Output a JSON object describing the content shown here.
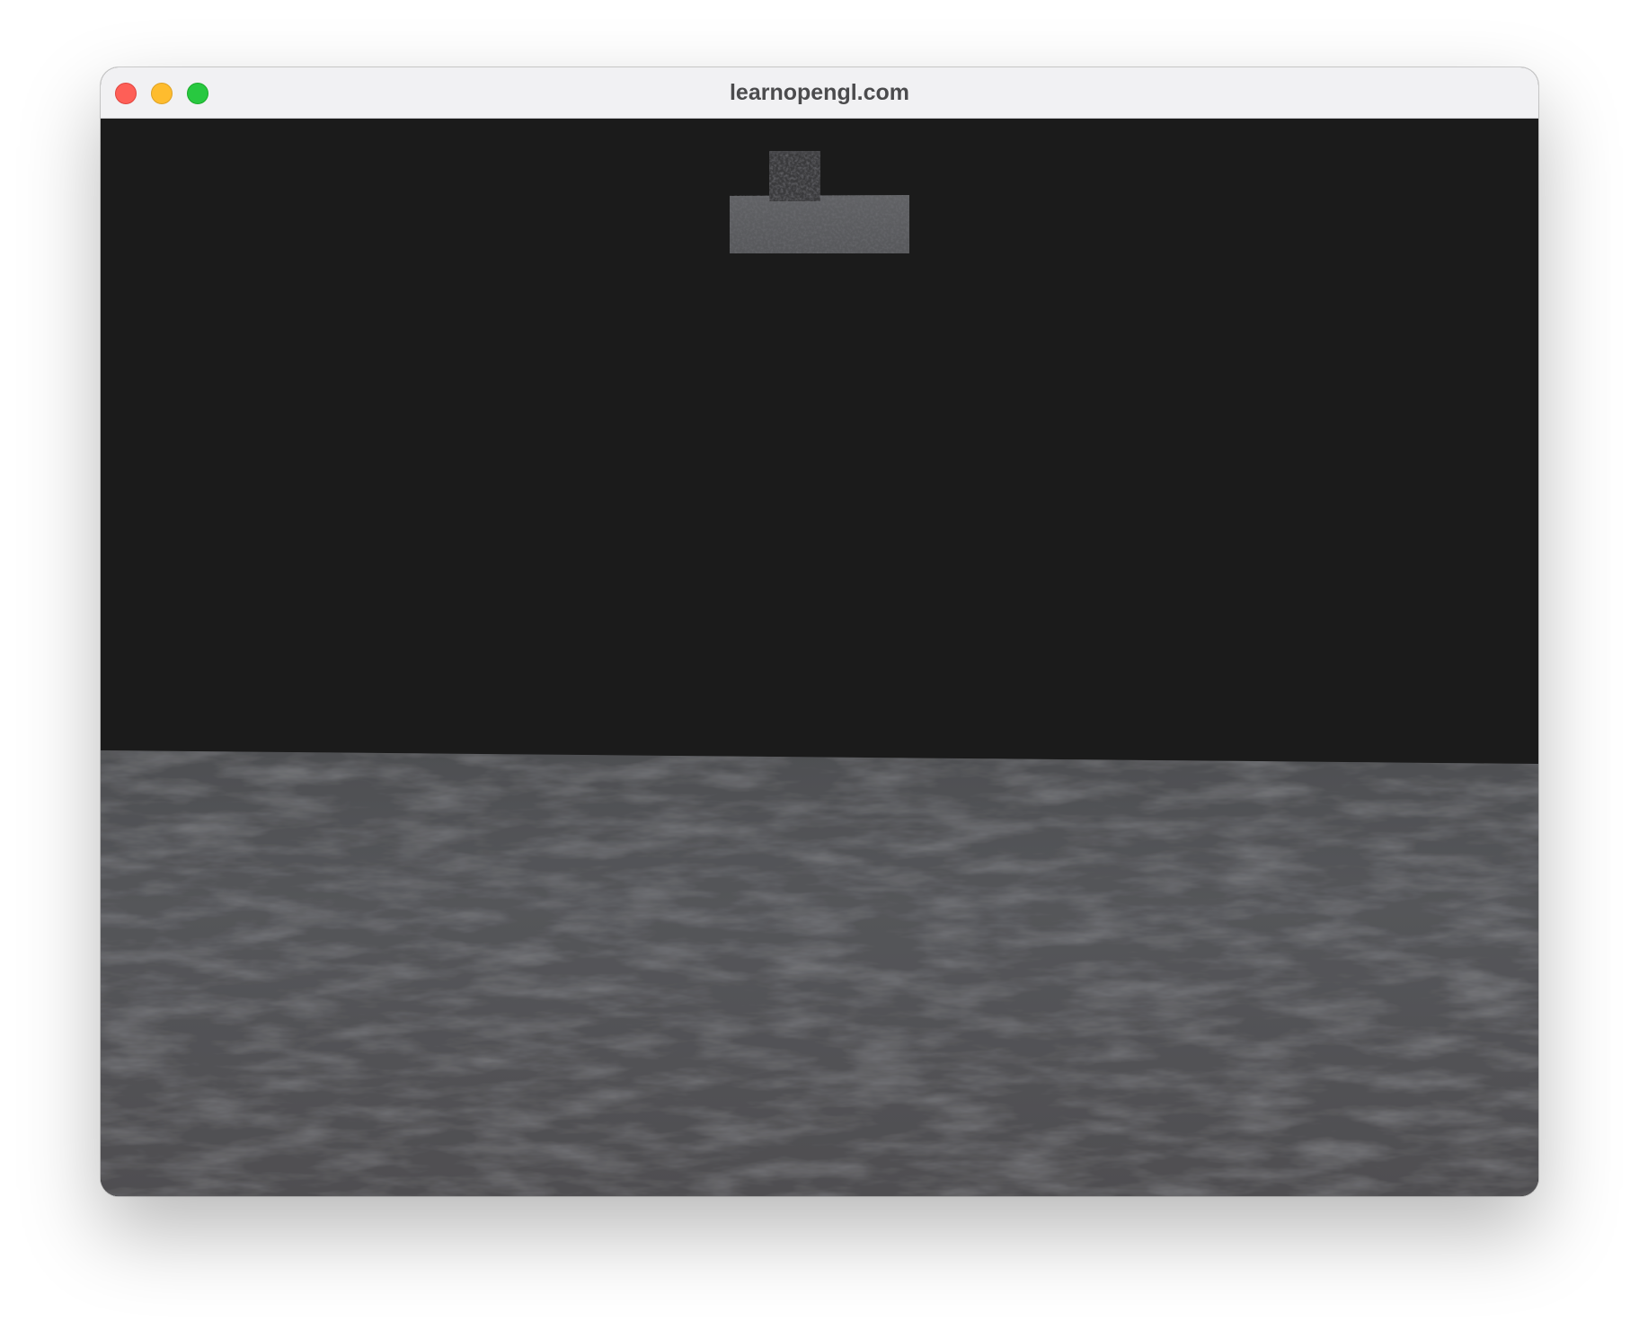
{
  "window": {
    "title": "learnopengl.com",
    "buttons": {
      "close": "close-button",
      "minimize": "minimize-button",
      "zoom": "zoom-button"
    }
  },
  "scene": {
    "clear_color": "#1b1b1b",
    "floor_color": "#54565a",
    "cube_color": "#3a3a3c"
  }
}
